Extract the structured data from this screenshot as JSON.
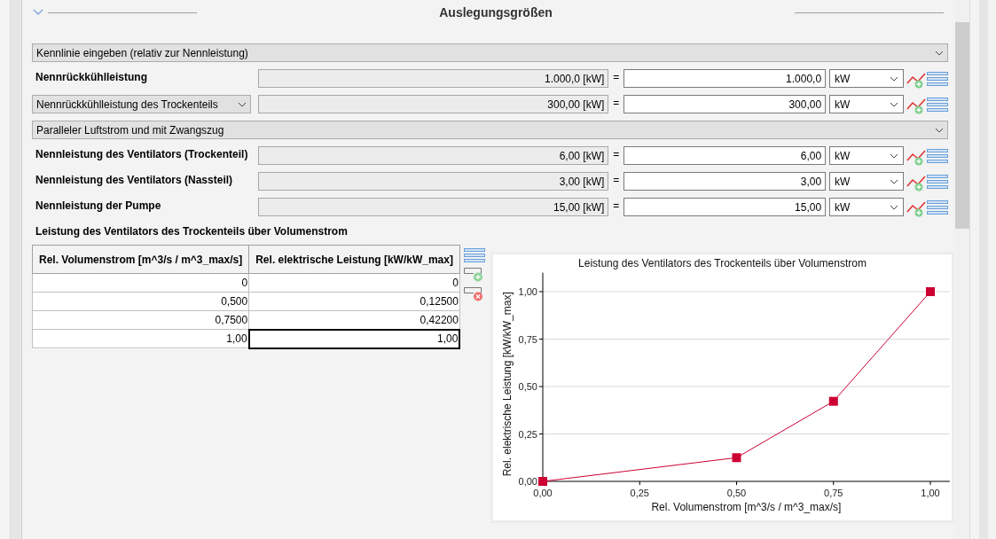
{
  "section": {
    "title": "Auslegungsgrößen",
    "expanded": true
  },
  "rows": [
    {
      "kind": "combo",
      "value": "Kennlinie eingeben (relativ zur Nennleistung)"
    },
    {
      "kind": "field",
      "label": "Nennrückkühlleistung",
      "computed": "1.000,0 [kW]",
      "equals": "=",
      "value": "1.000,0",
      "unit": "kW"
    },
    {
      "kind": "select-field",
      "label": "Nennrückkühlleistung des Trockenteils",
      "computed": "300,00 [kW]",
      "equals": "=",
      "value": "300,00",
      "unit": "kW"
    },
    {
      "kind": "combo",
      "value": "Paralleler Luftstrom und mit Zwangszug"
    },
    {
      "kind": "field",
      "label": "Nennleistung des Ventilators (Trockenteil)",
      "computed": "6,00 [kW]",
      "equals": "=",
      "value": "6,00",
      "unit": "kW"
    },
    {
      "kind": "field",
      "label": "Nennleistung des Ventilators (Nassteil)",
      "computed": "3,00 [kW]",
      "equals": "=",
      "value": "3,00",
      "unit": "kW"
    },
    {
      "kind": "field",
      "label": "Nennleistung der Pumpe",
      "computed": "15,00 [kW]",
      "equals": "=",
      "value": "15,00",
      "unit": "kW"
    }
  ],
  "table": {
    "title": "Leistung des Ventilators des Trockenteils über Volumenstrom",
    "columns": [
      "Rel. Volumenstrom [m^3/s / m^3_max/s]",
      "Rel. elektrische Leistung [kW/kW_max]"
    ],
    "rows": [
      {
        "cells": [
          {
            "text": "0",
            "selected": false
          },
          {
            "text": "0",
            "selected": false
          }
        ]
      },
      {
        "cells": [
          {
            "text": "0,500",
            "selected": false
          },
          {
            "text": "0,12500",
            "selected": false
          }
        ]
      },
      {
        "cells": [
          {
            "text": "0,7500",
            "selected": false
          },
          {
            "text": "0,42200",
            "selected": false
          }
        ]
      },
      {
        "cells": [
          {
            "text": "1,00",
            "selected": false
          },
          {
            "text": "1,00",
            "selected": true
          }
        ]
      }
    ]
  },
  "chart_data": {
    "type": "line",
    "title": "Leistung des Ventilators des Trockenteils über Volumenstrom",
    "xlabel": "Rel. Volumenstrom [m^3/s / m^3_max/s]",
    "ylabel": "Rel. elektrische Leistung [kW/kW_max]",
    "x": [
      0,
      0.5,
      0.75,
      1.0
    ],
    "series": [
      {
        "color": "#cc0033",
        "marker": "square",
        "values": [
          0,
          0.125,
          0.422,
          1.0
        ]
      }
    ],
    "grid": true,
    "xlim": [
      0,
      1.05
    ],
    "ylim": [
      0,
      1.1
    ],
    "xticks": [
      {
        "value": 0,
        "label": "0,00"
      },
      {
        "value": 0.25,
        "label": "0,25"
      },
      {
        "value": 0.5,
        "label": "0,50"
      },
      {
        "value": 0.75,
        "label": "0,75"
      },
      {
        "value": 1,
        "label": "1,00"
      }
    ],
    "yticks": [
      {
        "value": 0,
        "label": "0,00"
      },
      {
        "value": 0.25,
        "label": "0,25"
      },
      {
        "value": 0.5,
        "label": "0,50"
      },
      {
        "value": 0.75,
        "label": "0,75"
      },
      {
        "value": 1,
        "label": "1,00"
      }
    ]
  }
}
